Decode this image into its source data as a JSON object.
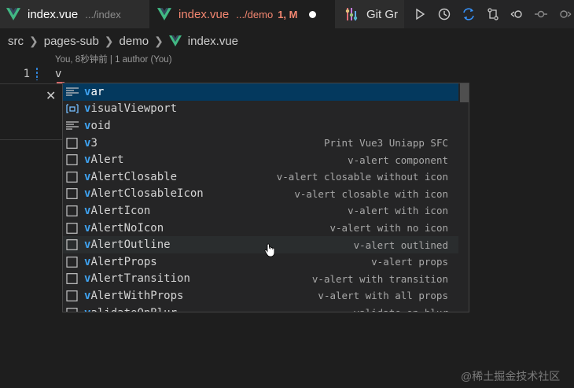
{
  "tabs": [
    {
      "name": "index.vue",
      "desc": ".../index"
    },
    {
      "name": "index.vue",
      "desc": ".../demo",
      "status": "1, M"
    },
    {
      "name": "Git Gr"
    }
  ],
  "colors": {
    "vue_green": "#41b883",
    "selected_bg": "#04395e",
    "match_blue": "#3fa2f0",
    "error_red": "#f48771"
  },
  "actions": [
    "run-icon",
    "history-icon",
    "sync-icon",
    "compare-icon",
    "go-back-icon",
    "commit-icon",
    "go-forward-icon"
  ],
  "breadcrumb": [
    "src",
    "pages-sub",
    "demo",
    "index.vue"
  ],
  "editor": {
    "codelens": "You, 8秒钟前 | 1 author (You)",
    "line_number": "1",
    "code": "v"
  },
  "suggestions": [
    {
      "match": "v",
      "rest": "ar",
      "detail": "",
      "kind": "snippet-icon"
    },
    {
      "match": "v",
      "rest": "isualViewport",
      "detail": "",
      "kind": "variable-icon"
    },
    {
      "match": "v",
      "rest": "oid",
      "detail": "",
      "kind": "snippet-icon"
    },
    {
      "match": "v",
      "rest": "3",
      "detail": "Print Vue3 Uniapp SFC",
      "kind": "snippet-box-icon"
    },
    {
      "match": "v",
      "rest": "Alert",
      "detail": "v-alert component",
      "kind": "snippet-box-icon"
    },
    {
      "match": "v",
      "rest": "AlertClosable",
      "detail": "v-alert closable without icon",
      "kind": "snippet-box-icon"
    },
    {
      "match": "v",
      "rest": "AlertClosableIcon",
      "detail": "v-alert closable with icon",
      "kind": "snippet-box-icon"
    },
    {
      "match": "v",
      "rest": "AlertIcon",
      "detail": "v-alert with icon",
      "kind": "snippet-box-icon"
    },
    {
      "match": "v",
      "rest": "AlertNoIcon",
      "detail": "v-alert with no icon",
      "kind": "snippet-box-icon"
    },
    {
      "match": "v",
      "rest": "AlertOutline",
      "detail": "v-alert outlined",
      "kind": "snippet-box-icon"
    },
    {
      "match": "v",
      "rest": "AlertProps",
      "detail": "v-alert props",
      "kind": "snippet-box-icon"
    },
    {
      "match": "v",
      "rest": "AlertTransition",
      "detail": "v-alert with transition",
      "kind": "snippet-box-icon"
    },
    {
      "match": "v",
      "rest": "AlertWithProps",
      "detail": "v-alert with all props",
      "kind": "snippet-box-icon"
    },
    {
      "match": "v",
      "rest": "alidateOnBlur",
      "detail": "validate on blur",
      "kind": "snippet-box-icon"
    }
  ],
  "watermark": "@稀土掘金技术社区"
}
